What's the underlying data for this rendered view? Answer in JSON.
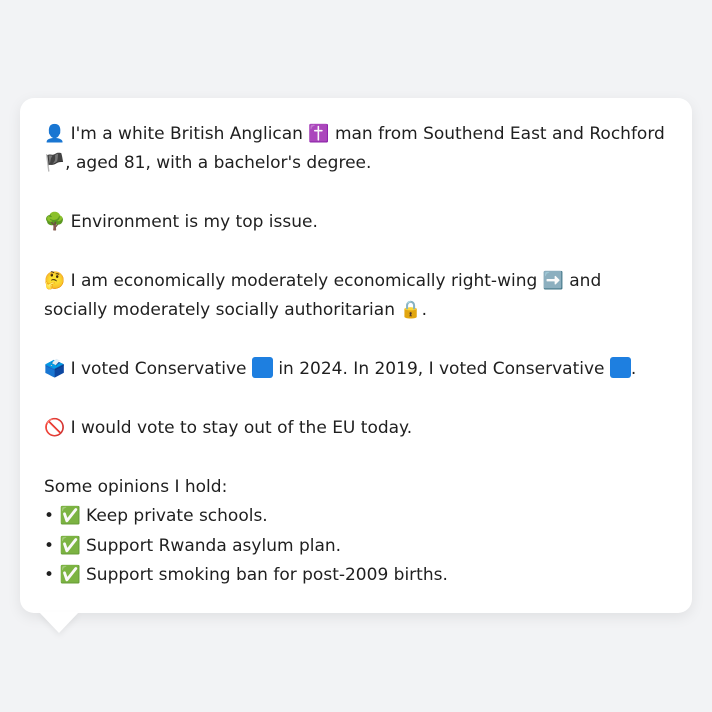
{
  "profile": {
    "identity": {
      "icon": "👤",
      "text_before": "I'm a white British Anglican",
      "religion_icon": "✝️",
      "text_middle": "man from Southend East and Rochford",
      "flag_icon": "🏴",
      "text_after": ", aged 81, with a bachelor's degree."
    },
    "issue": {
      "icon": "🌳",
      "text": "Environment is my top issue."
    },
    "ideology": {
      "icon": "🤔",
      "text_before": "I am economically moderately economically right-wing",
      "econ_icon": "➡️",
      "text_middle": "and socially moderately socially authoritarian",
      "social_icon": "🔒",
      "text_after": "."
    },
    "votes": {
      "icon": "🗳️",
      "text_2024": "I voted Conservative",
      "text_2024_after": "in 2024. In 2019, I voted Conservative",
      "text_end": ".",
      "party_color": "#1e7fe0"
    },
    "eu": {
      "icon": "🚫",
      "text": "I would vote to stay out of the EU today."
    },
    "opinions": {
      "heading": "Some opinions I hold:",
      "bullet": "•",
      "check_icon": "✅",
      "items": [
        "Keep private schools.",
        "Support Rwanda asylum plan.",
        "Support smoking ban for post-2009 births."
      ]
    }
  }
}
